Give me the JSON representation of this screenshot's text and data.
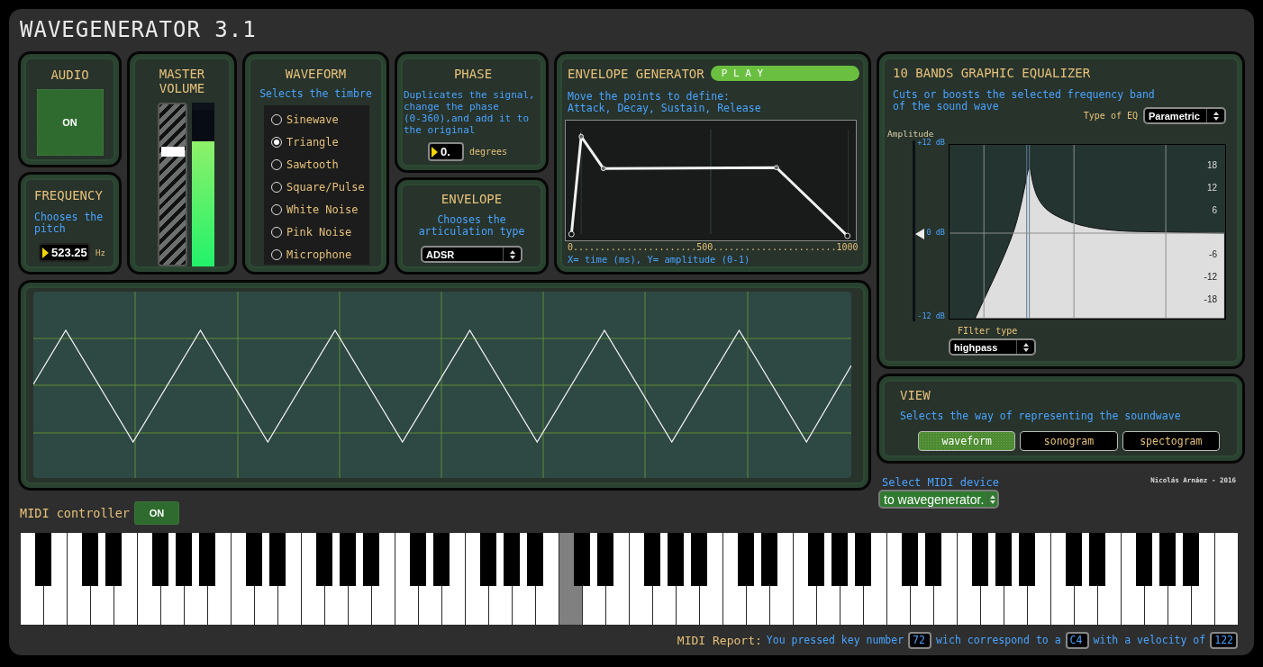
{
  "window": {
    "title": "WAVEGENERATOR 3.1"
  },
  "audio": {
    "title": "AUDIO",
    "button": {
      "label": "ON",
      "on": true
    }
  },
  "frequency": {
    "title": "FREQUENCY",
    "description": "Chooses the pitch",
    "value": "523.25",
    "unit": "Hz"
  },
  "master_volume": {
    "title": "MASTER VOLUME",
    "slider": {
      "level": 0.71
    },
    "meter": {
      "level": 0.8
    }
  },
  "waveform": {
    "title": "WAVEFORM",
    "description": "Selects the timbre",
    "options": [
      {
        "label": "Sinewave",
        "selected": false
      },
      {
        "label": "Triangle",
        "selected": true
      },
      {
        "label": "Sawtooth",
        "selected": false
      },
      {
        "label": "Square/Pulse",
        "selected": false
      },
      {
        "label": "White Noise",
        "selected": false
      },
      {
        "label": "Pink Noise",
        "selected": false
      },
      {
        "label": "Microphone",
        "selected": false
      }
    ]
  },
  "phase": {
    "title": "PHASE",
    "description": "Duplicates the signal, change the phase (0-360),and add it to the original",
    "value": "0.",
    "unit": "degrees"
  },
  "envelope": {
    "title": "ENVELOPE",
    "description": "Chooses the articulation type",
    "value": "ADSR"
  },
  "envelope_generator": {
    "title": "ENVELOPE GENERATOR",
    "play_button": "P L A Y",
    "instructions": [
      "Move the points to define:",
      "Attack, Decay, Sustain, Release"
    ],
    "axis": "0.......................500.......................1000",
    "caption": "X= time (ms), Y= amplitude (0-1)"
  },
  "equalizer": {
    "title": "10 BANDS GRAPHIC EQUALIZER",
    "description": "Cuts or boosts the selected frequency band of the sound wave",
    "eq_type_label": "Type of EQ",
    "eq_type": "Parametric",
    "amplitude_label": "Amplitude",
    "left_ticks": [
      "+12 dB",
      "0 dB",
      "-12 dB"
    ],
    "right_ticks": [
      "18",
      "12",
      "6",
      "-6",
      "-12",
      "-18"
    ],
    "filter_type_label": "FIlter type",
    "filter_type": "highpass"
  },
  "view": {
    "title": "VIEW",
    "description": "Selects the way of representing the soundwave",
    "options": [
      {
        "label": "waveform",
        "selected": true
      },
      {
        "label": "sonogram",
        "selected": false
      },
      {
        "label": "spectogram",
        "selected": false
      }
    ]
  },
  "midi_device": {
    "label": "Select MIDI device",
    "value": "to wavegenerator."
  },
  "credit": "Nicolás Arnáez - 2016",
  "midi_controller": {
    "label": "MIDI controller",
    "button": {
      "label": "ON",
      "on": true
    }
  },
  "keyboard": {
    "white_keys": [
      {
        "pressed": false
      },
      {
        "pressed": false
      },
      {
        "pressed": false
      },
      {
        "pressed": false
      },
      {
        "pressed": false
      },
      {
        "pressed": false
      },
      {
        "pressed": false
      },
      {
        "pressed": false
      },
      {
        "pressed": false
      },
      {
        "pressed": false
      },
      {
        "pressed": false
      },
      {
        "pressed": false
      },
      {
        "pressed": false
      },
      {
        "pressed": false
      },
      {
        "pressed": false
      },
      {
        "pressed": false
      },
      {
        "pressed": false
      },
      {
        "pressed": false
      },
      {
        "pressed": false
      },
      {
        "pressed": false
      },
      {
        "pressed": false
      },
      {
        "pressed": false
      },
      {
        "pressed": false
      },
      {
        "pressed": true
      },
      {
        "pressed": false
      },
      {
        "pressed": false
      },
      {
        "pressed": false
      },
      {
        "pressed": false
      },
      {
        "pressed": false
      },
      {
        "pressed": false
      },
      {
        "pressed": false
      },
      {
        "pressed": false
      },
      {
        "pressed": false
      },
      {
        "pressed": false
      },
      {
        "pressed": false
      },
      {
        "pressed": false
      },
      {
        "pressed": false
      },
      {
        "pressed": false
      },
      {
        "pressed": false
      },
      {
        "pressed": false
      },
      {
        "pressed": false
      },
      {
        "pressed": false
      },
      {
        "pressed": false
      },
      {
        "pressed": false
      },
      {
        "pressed": false
      },
      {
        "pressed": false
      },
      {
        "pressed": false
      },
      {
        "pressed": false
      },
      {
        "pressed": false
      },
      {
        "pressed": false
      },
      {
        "pressed": false
      },
      {
        "pressed": false
      }
    ]
  },
  "midi_report": {
    "label": "MIDI Report:",
    "segments": [
      {
        "kind": "text",
        "text": "You pressed key number"
      },
      {
        "kind": "value",
        "text": "72"
      },
      {
        "kind": "text",
        "text": "wich correspond to a"
      },
      {
        "kind": "value",
        "text": "C4"
      },
      {
        "kind": "text",
        "text": "with a velocity of"
      },
      {
        "kind": "value",
        "text": "122"
      }
    ]
  }
}
